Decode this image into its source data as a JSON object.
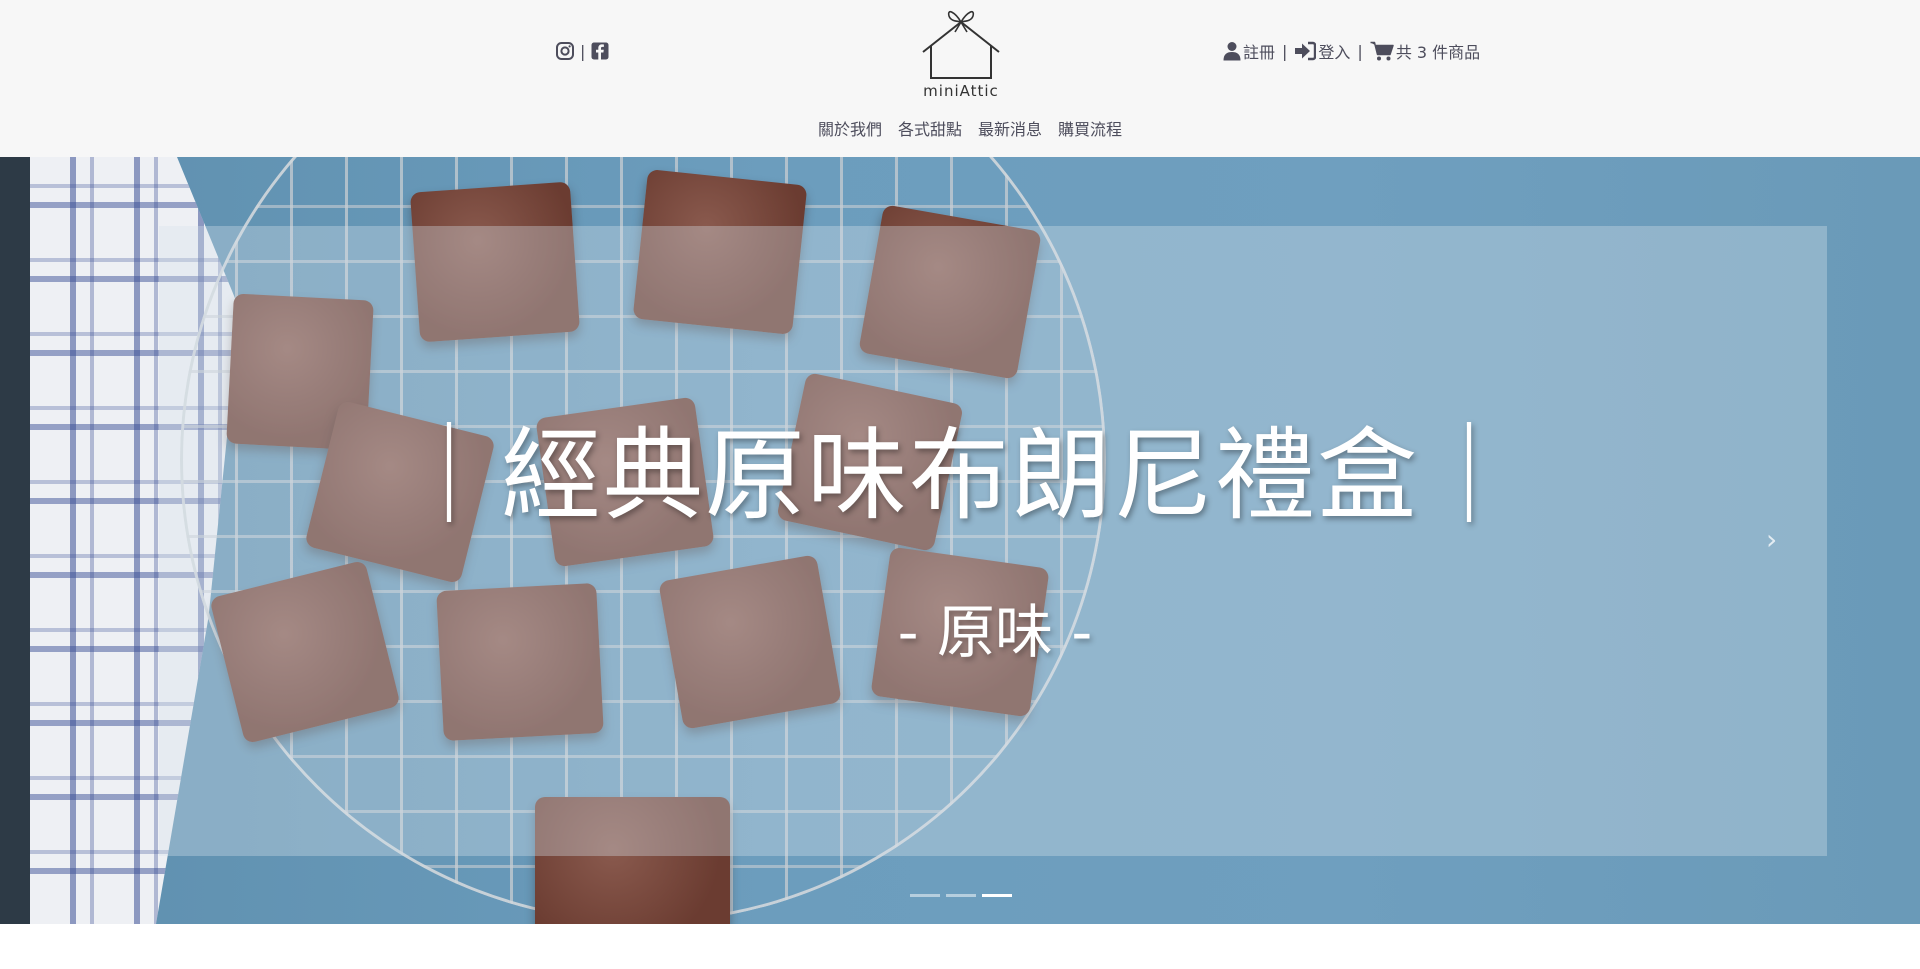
{
  "header": {
    "brand": "miniAttic",
    "social_separator": "|",
    "account": {
      "register_label": "註冊",
      "login_label": "登入",
      "separator": "|",
      "cart_label": "共 3 件商品"
    },
    "icons": {
      "instagram": "instagram-icon",
      "facebook": "facebook-icon",
      "user": "user-icon",
      "login": "sign-in-icon",
      "cart": "shopping-cart-icon"
    }
  },
  "nav": {
    "items": [
      {
        "label": "關於我們"
      },
      {
        "label": "各式甜點"
      },
      {
        "label": "最新消息"
      },
      {
        "label": "購買流程"
      }
    ]
  },
  "hero": {
    "title": "｜經典原味布朗尼禮盒｜",
    "subtitle": "- 原味 -",
    "next_arrow": "›",
    "slide_count": 3,
    "active_slide": 3
  },
  "colors": {
    "header_bg": "#f7f7f7",
    "text": "#4d4d5c",
    "hero_bg": "#6c9dbd"
  }
}
